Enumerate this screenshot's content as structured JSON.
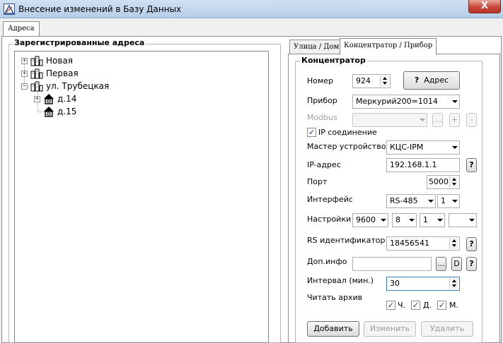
{
  "window": {
    "title": "Внесение изменений в Базу Данных",
    "close": "X"
  },
  "outer_tab": "Адреса",
  "tree": {
    "group_title": "Зарегистрированные адреса",
    "nodes": [
      {
        "label": "Новая",
        "sign": "+"
      },
      {
        "label": "Первая",
        "sign": "+"
      },
      {
        "label": "ул. Трубецкая",
        "sign": "−"
      },
      {
        "label": "д.14",
        "sign": "+"
      },
      {
        "label": "д.15"
      }
    ]
  },
  "inner_tabs": [
    "Улица / Дом",
    "Концентратор / Прибор"
  ],
  "form": {
    "group_title": "Концентратор",
    "number_label": "Номер",
    "number_value": "924",
    "address_btn": "Адрес",
    "address_btn_icon": "?",
    "device_label": "Прибор",
    "device_value": "Меркурий200=1014",
    "modbus_label": "Modbus",
    "modbus_dots": "...",
    "modbus_plus": "+",
    "modbus_minus": "-",
    "ip_checkbox_label": "IP соединение",
    "ip_checked": true,
    "master_label": "Мастер устройство",
    "master_value": "КЦС-IPM",
    "ip_label": "IP-адрес",
    "ip_value": "192.168.1.1",
    "help": "?",
    "port_label": "Порт",
    "port_value": "5000",
    "interface_label": "Интерфейс",
    "interface_value": "RS-485",
    "interface_num": "1",
    "settings_label": "Настройки",
    "baud": "9600",
    "databits": "8",
    "stopbits": "1",
    "parity": "",
    "rsid_label": "RS идентификатор",
    "rsid_value": "18456541",
    "extra_label": "Доп.инфо",
    "extra_value": "",
    "dots": "...",
    "d_btn": "D",
    "interval_label": "Интервал (мин.)",
    "interval_value": "30",
    "archive_label": "Читать архив",
    "archive_h": "Ч.",
    "archive_d": "Д.",
    "archive_m": "М.",
    "add_btn": "Добавить",
    "edit_btn": "Изменить",
    "delete_btn": "Удалить"
  }
}
